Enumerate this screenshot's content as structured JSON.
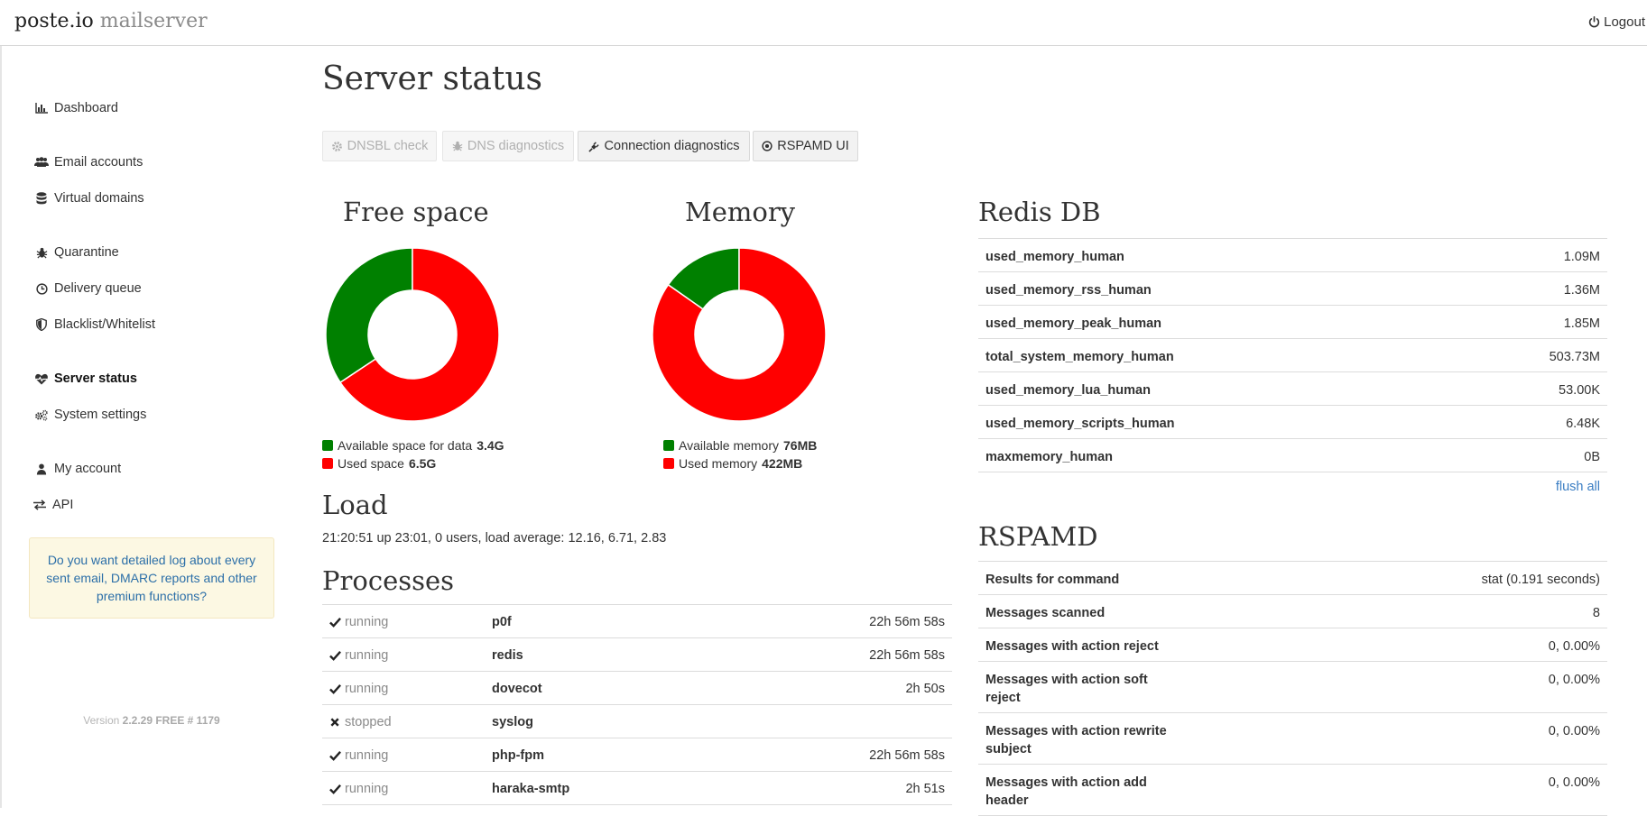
{
  "brand": {
    "name": "poste.io",
    "sub": "mailserver"
  },
  "topbar": {
    "logout_label": "Logout"
  },
  "sidebar": {
    "items": [
      {
        "label": "Dashboard"
      },
      {
        "label": "Email accounts"
      },
      {
        "label": "Virtual domains"
      },
      {
        "label": "Quarantine"
      },
      {
        "label": "Delivery queue"
      },
      {
        "label": "Blacklist/Whitelist"
      },
      {
        "label": "Server status"
      },
      {
        "label": "System settings"
      },
      {
        "label": "My account"
      },
      {
        "label": "API"
      }
    ],
    "active": "Server status",
    "promo": "Do you want detailed log about every sent email, DMARC reports and other premium functions?",
    "version_prefix": "Version",
    "version_value": "2.2.29 FREE # 1179"
  },
  "page": {
    "title": "Server status"
  },
  "toolbar": {
    "dnsbl": "DNSBL check",
    "dns_diag": "DNS diagnostics",
    "conn_diag": "Connection diagnostics",
    "rspamd_ui": "RSPAMD UI"
  },
  "colors": {
    "available": "#008000",
    "used": "#ff0000"
  },
  "chart_data": [
    {
      "type": "pie",
      "title": "Free space",
      "labels": [
        "Available space for data",
        "Used space"
      ],
      "display": [
        "3.4G",
        "6.5G"
      ],
      "values": [
        3.4,
        6.5
      ],
      "colors": [
        "#008000",
        "#ff0000"
      ]
    },
    {
      "type": "pie",
      "title": "Memory",
      "labels": [
        "Available memory",
        "Used memory"
      ],
      "display": [
        "76MB",
        "422MB"
      ],
      "values": [
        76,
        422
      ],
      "colors": [
        "#008000",
        "#ff0000"
      ]
    }
  ],
  "load": {
    "title": "Load",
    "text": "21:20:51 up 23:01, 0 users, load average: 12.16, 6.71, 2.83"
  },
  "processes": {
    "title": "Processes",
    "rows": [
      {
        "status": "running",
        "name": "p0f",
        "uptime": "22h 56m 58s"
      },
      {
        "status": "running",
        "name": "redis",
        "uptime": "22h 56m 58s"
      },
      {
        "status": "running",
        "name": "dovecot",
        "uptime": "2h 50s"
      },
      {
        "status": "stopped",
        "name": "syslog",
        "uptime": ""
      },
      {
        "status": "running",
        "name": "php-fpm",
        "uptime": "22h 56m 58s"
      },
      {
        "status": "running",
        "name": "haraka-smtp",
        "uptime": "2h 51s"
      }
    ]
  },
  "redis": {
    "title": "Redis DB",
    "rows": [
      {
        "key": "used_memory_human",
        "value": "1.09M"
      },
      {
        "key": "used_memory_rss_human",
        "value": "1.36M"
      },
      {
        "key": "used_memory_peak_human",
        "value": "1.85M"
      },
      {
        "key": "total_system_memory_human",
        "value": "503.73M"
      },
      {
        "key": "used_memory_lua_human",
        "value": "53.00K"
      },
      {
        "key": "used_memory_scripts_human",
        "value": "6.48K"
      },
      {
        "key": "maxmemory_human",
        "value": "0B"
      }
    ],
    "flush_label": "flush all"
  },
  "rspamd": {
    "title": "RSPAMD",
    "rows": [
      {
        "key": "Results for command",
        "value": "stat (0.191 seconds)"
      },
      {
        "key": "Messages scanned",
        "value": "8"
      },
      {
        "key": "Messages with action reject",
        "value": "0, 0.00%"
      },
      {
        "key": "Messages with action soft reject",
        "value": "0, 0.00%"
      },
      {
        "key": "Messages with action rewrite subject",
        "value": "0, 0.00%"
      },
      {
        "key": "Messages with action add header",
        "value": "0, 0.00%"
      }
    ]
  }
}
